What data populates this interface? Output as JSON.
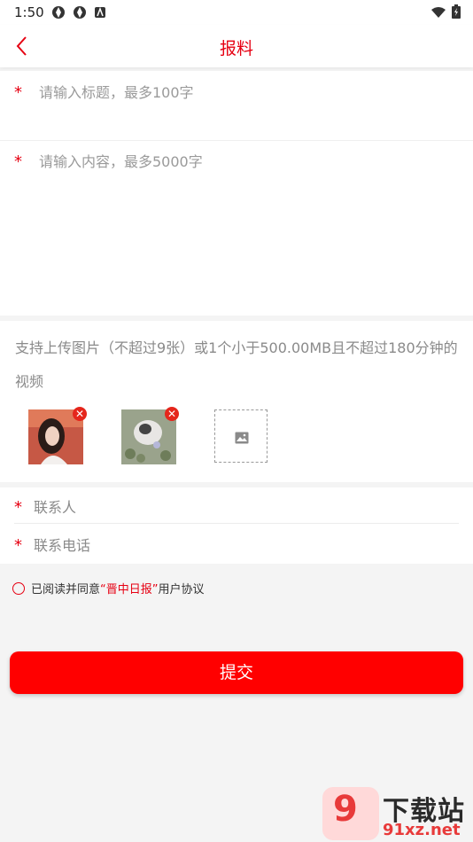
{
  "status_bar": {
    "time": "1:50"
  },
  "header": {
    "title": "报料"
  },
  "form": {
    "required_mark": "*",
    "title_placeholder": "请输入标题，最多100字",
    "content_placeholder": "请输入内容，最多5000字",
    "upload_hint": "支持上传图片（不超过9张）或1个小于500.00MB且不超过180分钟的视频",
    "contact_name_placeholder": "联系人",
    "contact_phone_placeholder": "联系电话"
  },
  "agreement": {
    "prefix": "已阅读并同意",
    "brand": "“晋中日报”",
    "suffix": "用户协议"
  },
  "submit_label": "提交",
  "watermark": {
    "text": "下载站",
    "domain": "91xz.net",
    "mark": "9"
  },
  "colors": {
    "accent": "#e60012",
    "button": "#ff0000"
  }
}
